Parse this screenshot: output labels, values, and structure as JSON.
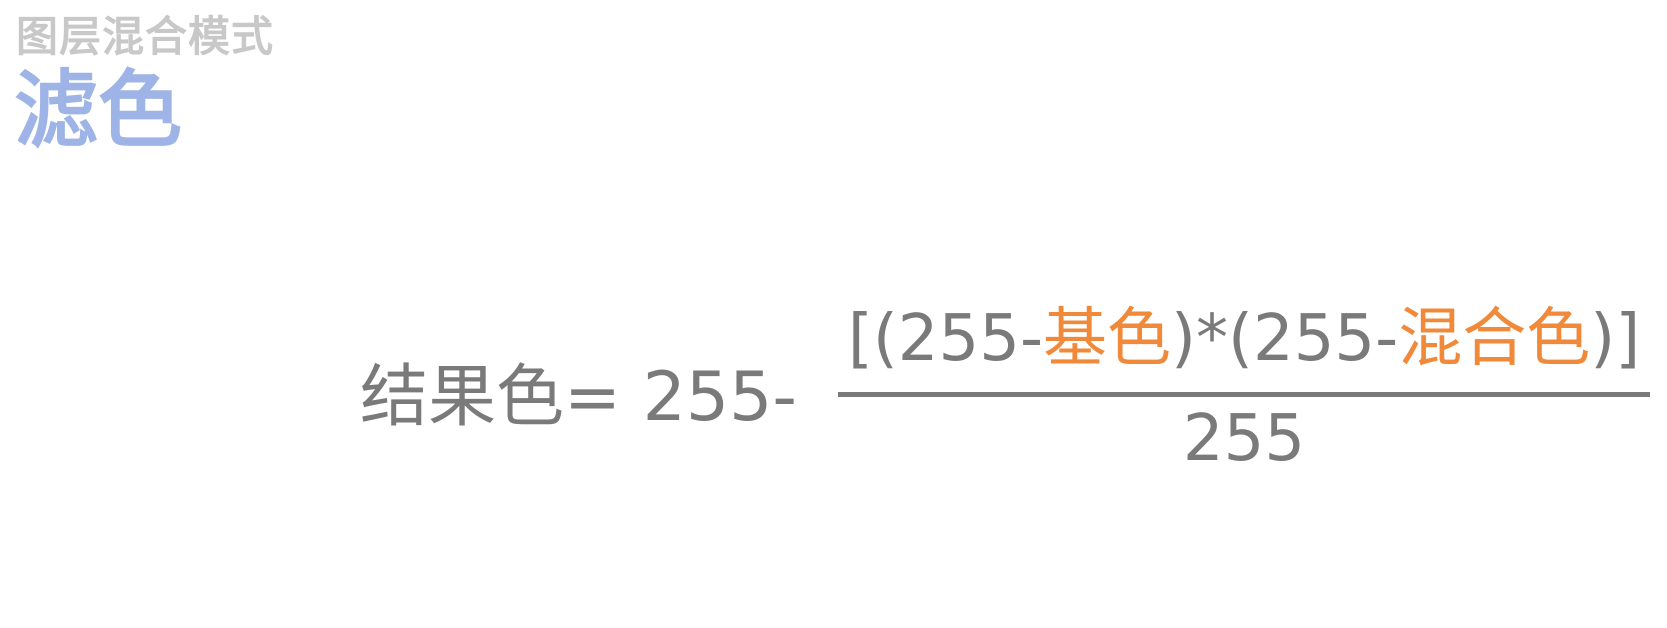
{
  "header": {
    "subtitle": "图层混合模式",
    "title": "滤色"
  },
  "formula": {
    "lhs": "结果色= 255-",
    "numerator": {
      "open": "[(255-",
      "term1": "基色",
      "middle": ")*(255-",
      "term2": "混合色",
      "close": ")]"
    },
    "denominator": "255"
  },
  "colors": {
    "title": "#9fb4e6",
    "subtitle": "#c8c8c8",
    "text": "#7a7a7a",
    "highlight": "#f08a3a"
  }
}
